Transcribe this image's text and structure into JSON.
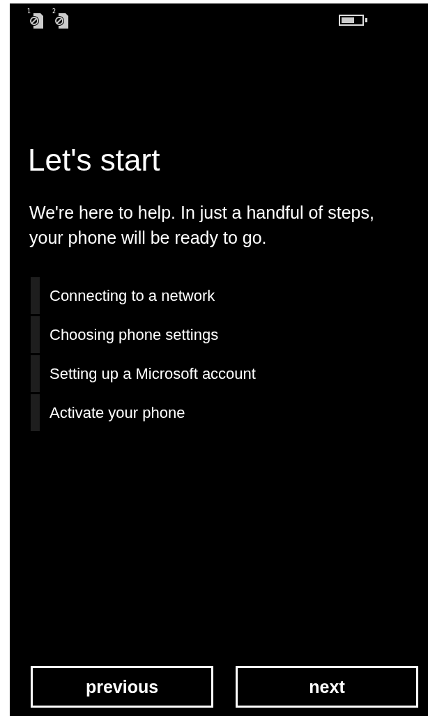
{
  "status_bar": {
    "sim_slots": [
      {
        "label": "1"
      },
      {
        "label": "2"
      }
    ]
  },
  "title": "Let's start",
  "intro": "We're here to help. In just a handful of steps, your phone will be ready to go.",
  "steps": [
    {
      "label": "Connecting to a network"
    },
    {
      "label": "Choosing phone settings"
    },
    {
      "label": "Setting up a Microsoft account"
    },
    {
      "label": "Activate your phone"
    }
  ],
  "buttons": [
    {
      "label": "previous"
    },
    {
      "label": "next"
    }
  ]
}
